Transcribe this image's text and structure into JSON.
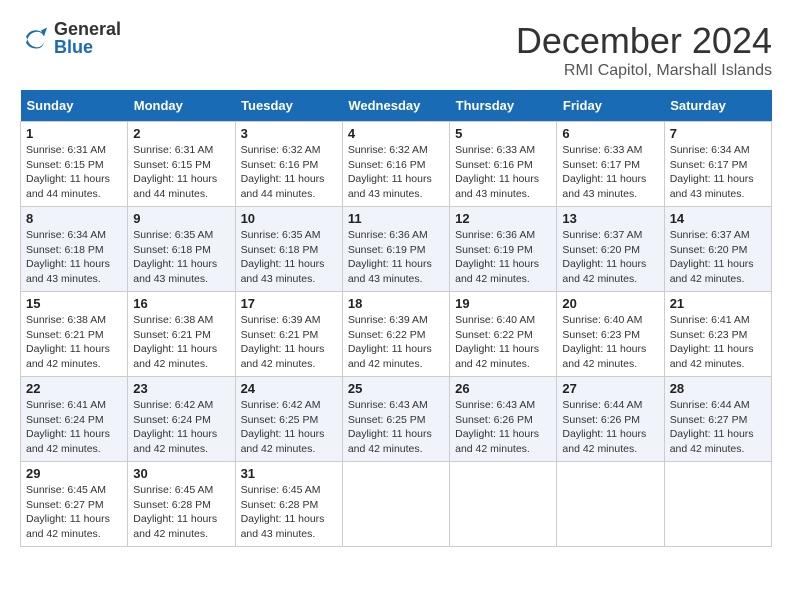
{
  "logo": {
    "general": "General",
    "blue": "Blue"
  },
  "title": {
    "month": "December 2024",
    "location": "RMI Capitol, Marshall Islands"
  },
  "weekdays": [
    "Sunday",
    "Monday",
    "Tuesday",
    "Wednesday",
    "Thursday",
    "Friday",
    "Saturday"
  ],
  "weeks": [
    [
      {
        "day": "1",
        "sunrise": "6:31 AM",
        "sunset": "6:15 PM",
        "daylight": "11 hours and 44 minutes."
      },
      {
        "day": "2",
        "sunrise": "6:31 AM",
        "sunset": "6:15 PM",
        "daylight": "11 hours and 44 minutes."
      },
      {
        "day": "3",
        "sunrise": "6:32 AM",
        "sunset": "6:16 PM",
        "daylight": "11 hours and 44 minutes."
      },
      {
        "day": "4",
        "sunrise": "6:32 AM",
        "sunset": "6:16 PM",
        "daylight": "11 hours and 43 minutes."
      },
      {
        "day": "5",
        "sunrise": "6:33 AM",
        "sunset": "6:16 PM",
        "daylight": "11 hours and 43 minutes."
      },
      {
        "day": "6",
        "sunrise": "6:33 AM",
        "sunset": "6:17 PM",
        "daylight": "11 hours and 43 minutes."
      },
      {
        "day": "7",
        "sunrise": "6:34 AM",
        "sunset": "6:17 PM",
        "daylight": "11 hours and 43 minutes."
      }
    ],
    [
      {
        "day": "8",
        "sunrise": "6:34 AM",
        "sunset": "6:18 PM",
        "daylight": "11 hours and 43 minutes."
      },
      {
        "day": "9",
        "sunrise": "6:35 AM",
        "sunset": "6:18 PM",
        "daylight": "11 hours and 43 minutes."
      },
      {
        "day": "10",
        "sunrise": "6:35 AM",
        "sunset": "6:18 PM",
        "daylight": "11 hours and 43 minutes."
      },
      {
        "day": "11",
        "sunrise": "6:36 AM",
        "sunset": "6:19 PM",
        "daylight": "11 hours and 43 minutes."
      },
      {
        "day": "12",
        "sunrise": "6:36 AM",
        "sunset": "6:19 PM",
        "daylight": "11 hours and 42 minutes."
      },
      {
        "day": "13",
        "sunrise": "6:37 AM",
        "sunset": "6:20 PM",
        "daylight": "11 hours and 42 minutes."
      },
      {
        "day": "14",
        "sunrise": "6:37 AM",
        "sunset": "6:20 PM",
        "daylight": "11 hours and 42 minutes."
      }
    ],
    [
      {
        "day": "15",
        "sunrise": "6:38 AM",
        "sunset": "6:21 PM",
        "daylight": "11 hours and 42 minutes."
      },
      {
        "day": "16",
        "sunrise": "6:38 AM",
        "sunset": "6:21 PM",
        "daylight": "11 hours and 42 minutes."
      },
      {
        "day": "17",
        "sunrise": "6:39 AM",
        "sunset": "6:21 PM",
        "daylight": "11 hours and 42 minutes."
      },
      {
        "day": "18",
        "sunrise": "6:39 AM",
        "sunset": "6:22 PM",
        "daylight": "11 hours and 42 minutes."
      },
      {
        "day": "19",
        "sunrise": "6:40 AM",
        "sunset": "6:22 PM",
        "daylight": "11 hours and 42 minutes."
      },
      {
        "day": "20",
        "sunrise": "6:40 AM",
        "sunset": "6:23 PM",
        "daylight": "11 hours and 42 minutes."
      },
      {
        "day": "21",
        "sunrise": "6:41 AM",
        "sunset": "6:23 PM",
        "daylight": "11 hours and 42 minutes."
      }
    ],
    [
      {
        "day": "22",
        "sunrise": "6:41 AM",
        "sunset": "6:24 PM",
        "daylight": "11 hours and 42 minutes."
      },
      {
        "day": "23",
        "sunrise": "6:42 AM",
        "sunset": "6:24 PM",
        "daylight": "11 hours and 42 minutes."
      },
      {
        "day": "24",
        "sunrise": "6:42 AM",
        "sunset": "6:25 PM",
        "daylight": "11 hours and 42 minutes."
      },
      {
        "day": "25",
        "sunrise": "6:43 AM",
        "sunset": "6:25 PM",
        "daylight": "11 hours and 42 minutes."
      },
      {
        "day": "26",
        "sunrise": "6:43 AM",
        "sunset": "6:26 PM",
        "daylight": "11 hours and 42 minutes."
      },
      {
        "day": "27",
        "sunrise": "6:44 AM",
        "sunset": "6:26 PM",
        "daylight": "11 hours and 42 minutes."
      },
      {
        "day": "28",
        "sunrise": "6:44 AM",
        "sunset": "6:27 PM",
        "daylight": "11 hours and 42 minutes."
      }
    ],
    [
      {
        "day": "29",
        "sunrise": "6:45 AM",
        "sunset": "6:27 PM",
        "daylight": "11 hours and 42 minutes."
      },
      {
        "day": "30",
        "sunrise": "6:45 AM",
        "sunset": "6:28 PM",
        "daylight": "11 hours and 42 minutes."
      },
      {
        "day": "31",
        "sunrise": "6:45 AM",
        "sunset": "6:28 PM",
        "daylight": "11 hours and 43 minutes."
      },
      null,
      null,
      null,
      null
    ]
  ],
  "labels": {
    "sunrise": "Sunrise:",
    "sunset": "Sunset:",
    "daylight": "Daylight:"
  }
}
